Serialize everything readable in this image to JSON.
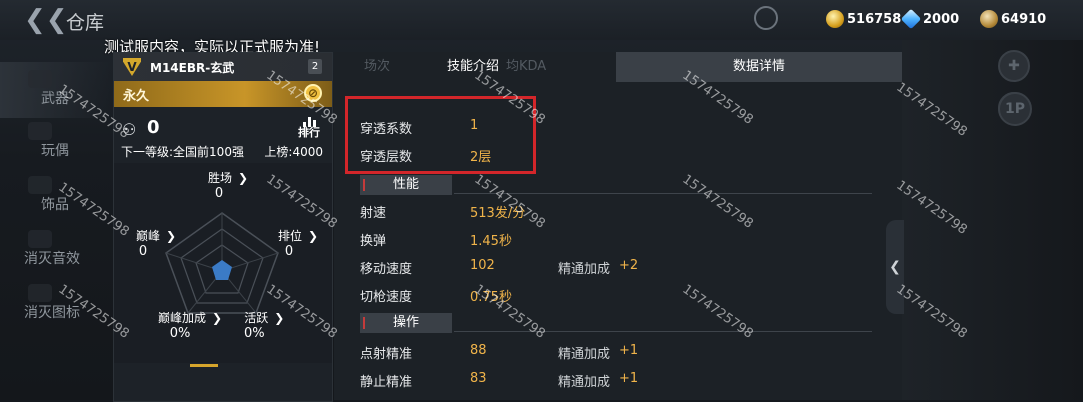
{
  "topbar": {
    "title": "仓库"
  },
  "currencies": [
    {
      "icon": "gold-coin-icon",
      "value": "516758"
    },
    {
      "icon": "diamond-icon",
      "value": "2000"
    },
    {
      "icon": "badge-coin-icon",
      "value": "64910"
    }
  ],
  "notice": "测试服内容，实际以正式服为准!",
  "nav": [
    {
      "label": "武器"
    },
    {
      "label": "玩偶"
    },
    {
      "label": "饰品"
    },
    {
      "label": "消灭音效"
    },
    {
      "label": "消灭图标"
    }
  ],
  "card": {
    "weapon_name": "M14EBR-玄武",
    "badge": "2",
    "permanence": "永久",
    "kills": "0",
    "rank_label": "排行",
    "next_level": "下一等级:全国前100强",
    "upboard": "上榜:4000",
    "stats": {
      "wins": {
        "label": "胜场",
        "value": "0"
      },
      "peak": {
        "label": "巅峰",
        "value": "0"
      },
      "rank": {
        "label": "排位",
        "value": "0"
      },
      "peak_bonus": {
        "label": "巅峰加成",
        "value": "0%"
      },
      "active": {
        "label": "活跃",
        "value": "0%"
      }
    }
  },
  "tabs": {
    "ghost_matches": "场次",
    "ghost_kda": "均KDA",
    "skill": "技能介绍",
    "data": "数据详情"
  },
  "penetration": [
    {
      "key": "穿透系数",
      "value": "1"
    },
    {
      "key": "穿透层数",
      "value": "2层"
    }
  ],
  "sections": {
    "performance": "性能",
    "operation": "操作"
  },
  "performance_rows": [
    {
      "key": "射速",
      "value": "513发/分",
      "mod_label": "",
      "mod_value": ""
    },
    {
      "key": "换弹",
      "value": "1.45秒",
      "mod_label": "",
      "mod_value": ""
    },
    {
      "key": "移动速度",
      "value": "102",
      "mod_label": "精通加成",
      "mod_value": "+2"
    },
    {
      "key": "切枪速度",
      "value": "0.75秒",
      "mod_label": "",
      "mod_value": ""
    }
  ],
  "operation_rows": [
    {
      "key": "点射精准",
      "value": "88",
      "mod_label": "精通加成",
      "mod_value": "+1"
    },
    {
      "key": "静止精准",
      "value": "83",
      "mod_label": "精通加成",
      "mod_value": "+1"
    }
  ],
  "right_buttons": {
    "p1": "1P"
  },
  "watermark": "1574725798"
}
